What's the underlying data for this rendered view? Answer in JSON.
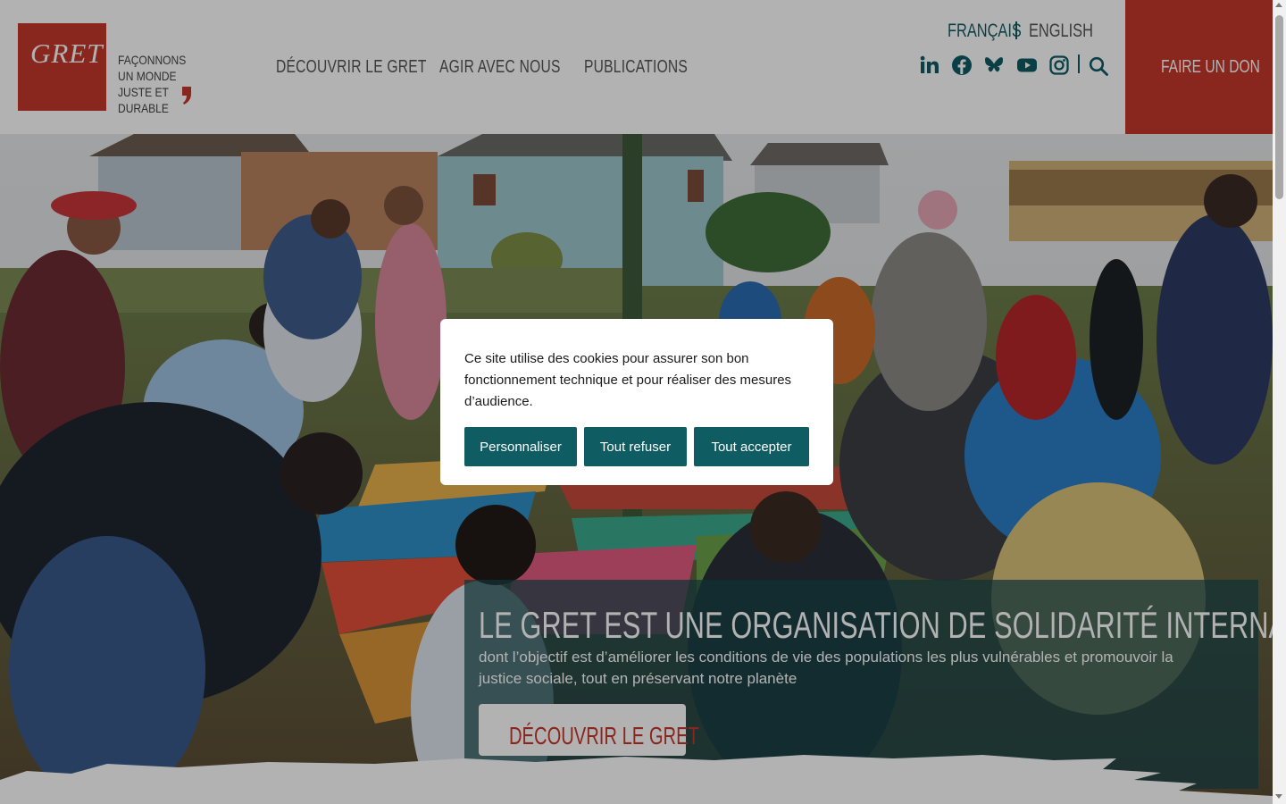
{
  "brand": {
    "logo_text": "GRET",
    "tagline": "FAÇONNONS UN MONDE JUSTE ET DURABLE",
    "color": "#c4372a"
  },
  "nav": {
    "items": [
      {
        "label": "DÉCOUVRIR LE GRET"
      },
      {
        "label": "AGIR AVEC NOUS"
      },
      {
        "label": "PUBLICATIONS"
      }
    ]
  },
  "language": {
    "fr": "FRANÇAIS",
    "en": "ENGLISH",
    "active": "FRANÇAIS"
  },
  "social": [
    "linkedin-icon",
    "facebook-icon",
    "bluesky-icon",
    "youtube-icon",
    "instagram-icon"
  ],
  "donate": {
    "label": "FAIRE UN DON"
  },
  "hero": {
    "title": "LE GRET EST UNE ORGANISATION DE SOLIDARITÉ INTERNATIONALE",
    "subtitle": "dont l’objectif est d’améliorer les conditions de vie des populations les plus vulnérables et promouvoir la justice sociale, tout en préservant notre planète",
    "button": "DÉCOUVRIR LE GRET"
  },
  "cookie": {
    "text": "Ce site utilise des cookies pour assurer son bon fonctionnement technique et pour réaliser des mesures d’audience.",
    "customize": "Personnaliser",
    "refuse": "Tout refuser",
    "accept": "Tout accepter"
  },
  "colors": {
    "teal": "#0f5c63",
    "red": "#c4372a"
  }
}
